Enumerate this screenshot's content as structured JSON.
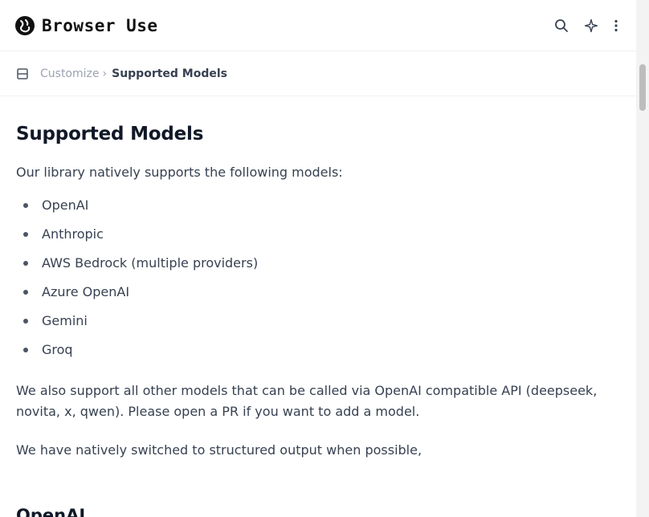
{
  "header": {
    "logo_text": "Browser Use",
    "search_icon": "search-icon",
    "assistant_icon": "sparkle-icon",
    "more_icon": "more-vertical-icon"
  },
  "breadcrumb": {
    "menu_icon": "menu-icon",
    "parent": "Customize",
    "separator": "›",
    "current": "Supported Models"
  },
  "content": {
    "title": "Supported Models",
    "intro": "Our library natively supports the following models:",
    "models": [
      "OpenAI",
      "Anthropic",
      "AWS Bedrock (multiple providers)",
      "Azure OpenAI",
      "Gemini",
      "Groq"
    ],
    "paragraph1": "We also support all other models that can be called via OpenAI compatible API (deepseek, novita, x, qwen). Please open a PR if you want to add a model.",
    "paragraph2": "We have natively switched to structured output when possible,",
    "next_heading": "OpenAI"
  },
  "colors": {
    "text": "#374151",
    "heading": "#111827",
    "muted": "#9ca3af"
  }
}
